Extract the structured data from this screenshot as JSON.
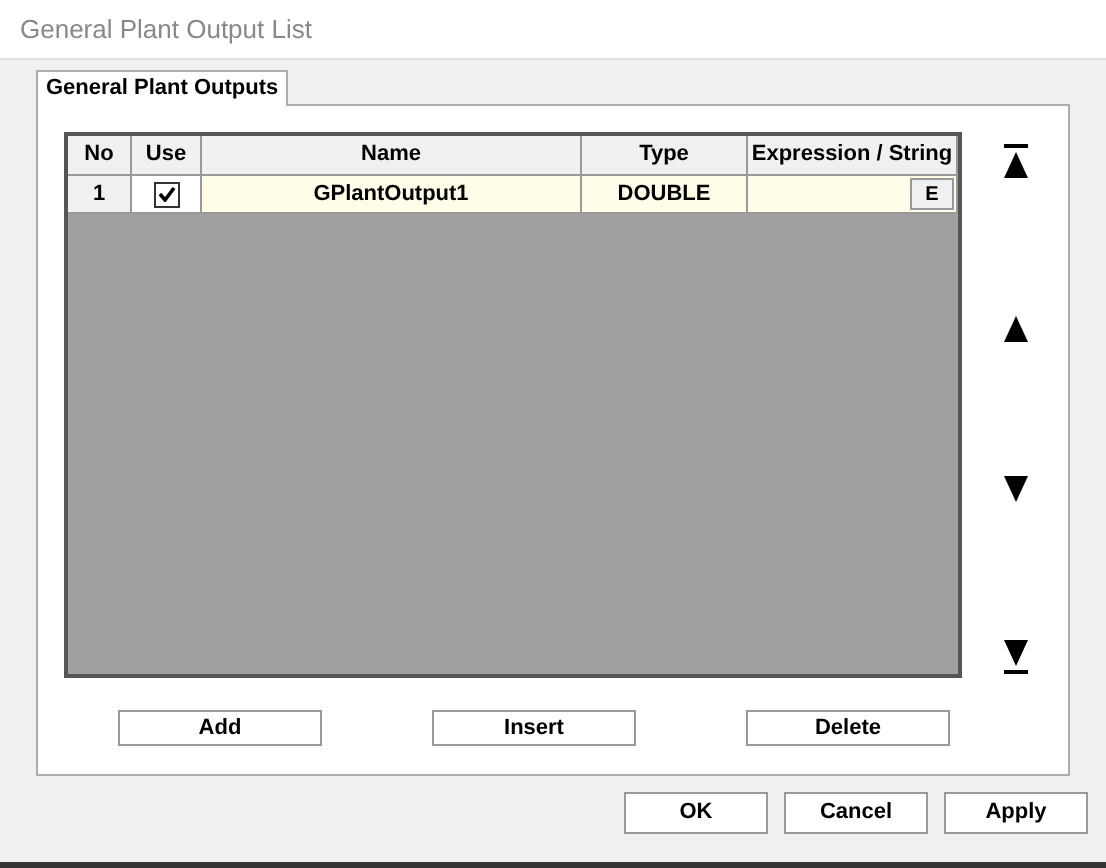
{
  "window": {
    "title": "General Plant Output List"
  },
  "tabs": [
    {
      "label": "General Plant Outputs",
      "selected": true
    }
  ],
  "table": {
    "columns": [
      "No",
      "Use",
      "Name",
      "Type",
      "Expression / String"
    ],
    "rows": [
      {
        "no": "1",
        "use": true,
        "name": "GPlantOutput1",
        "type": "DOUBLE",
        "edit_button": "E"
      }
    ]
  },
  "list_buttons": [
    "Add",
    "Insert",
    "Delete"
  ],
  "dialog_buttons": [
    "OK",
    "Cancel",
    "Apply"
  ]
}
